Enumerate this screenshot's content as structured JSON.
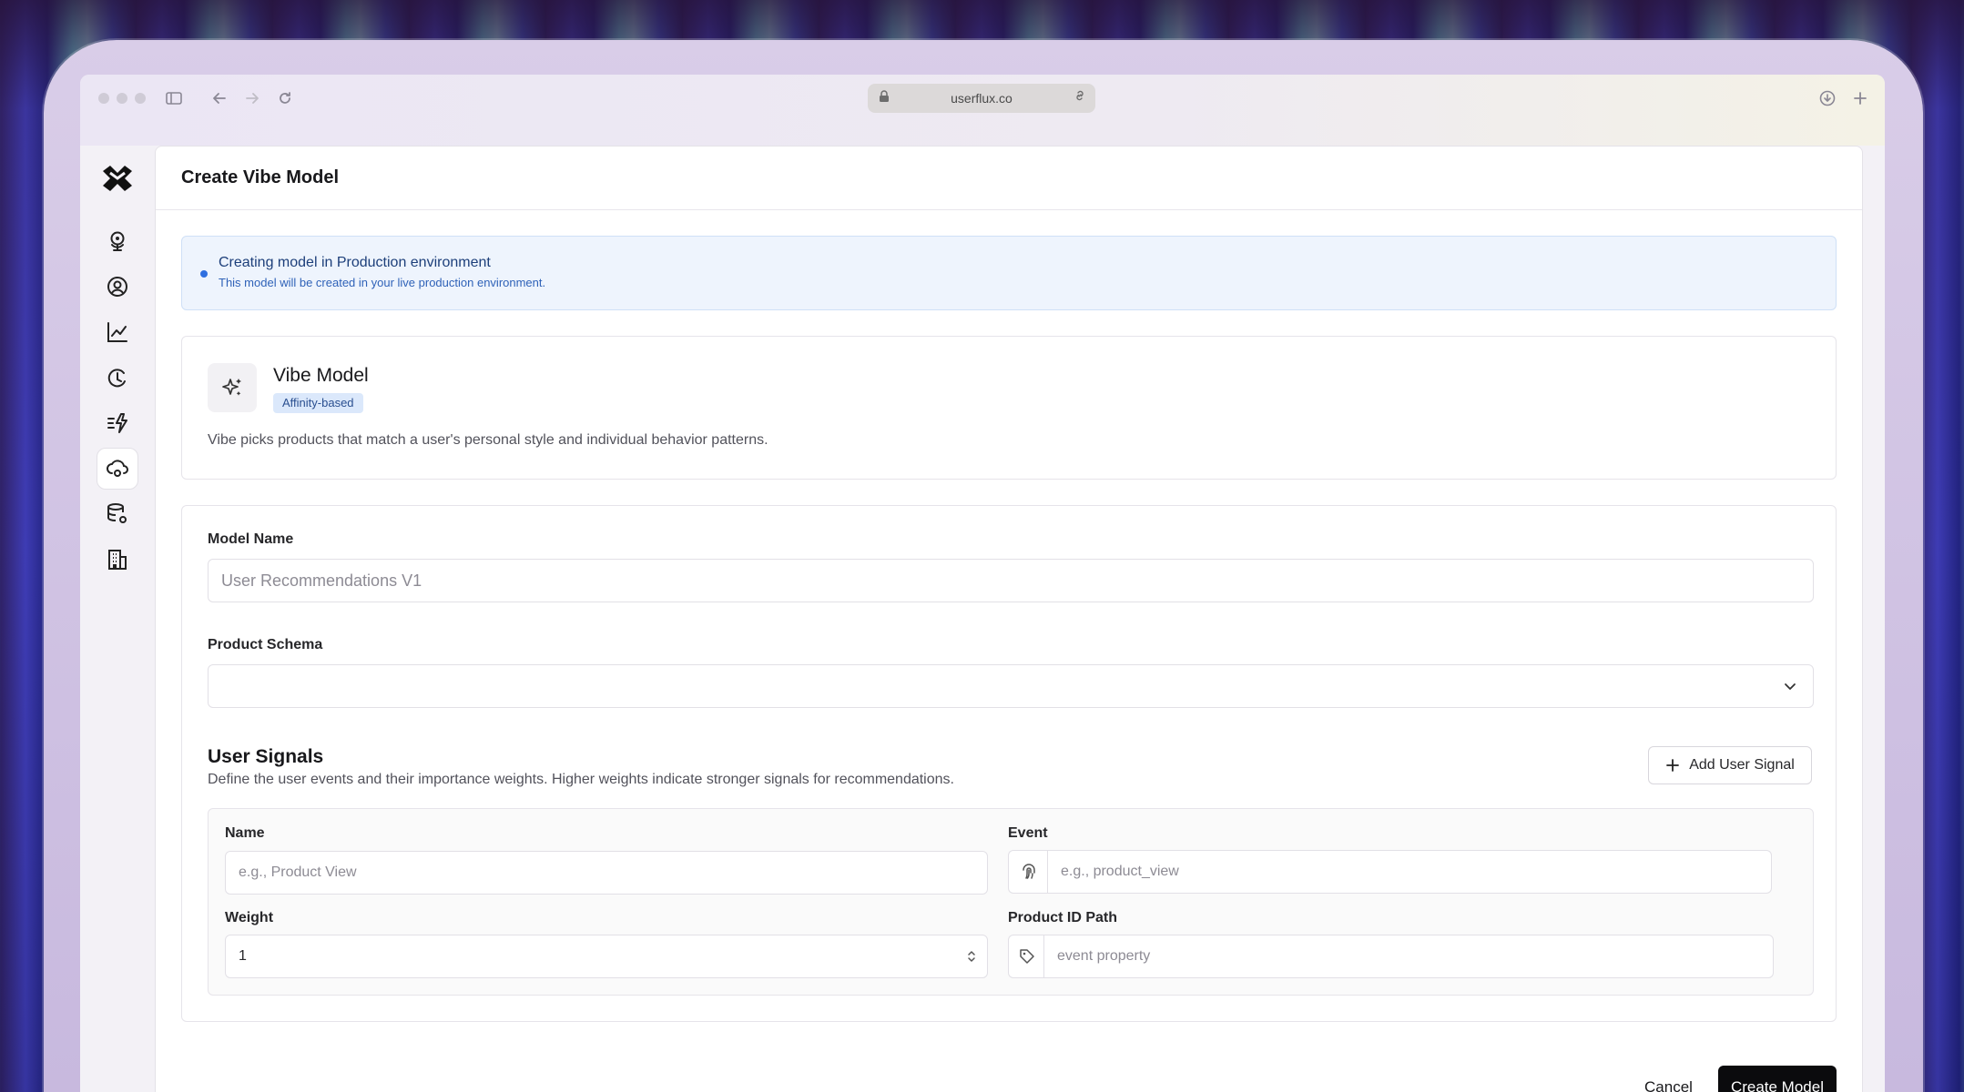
{
  "browser": {
    "url": "userflux.co"
  },
  "page": {
    "title": "Create Vibe Model"
  },
  "banner": {
    "title": "Creating model in Production environment",
    "subtitle": "This model will be created in your live production environment."
  },
  "model": {
    "name": "Vibe Model",
    "badge": "Affinity-based",
    "description": "Vibe picks products that match a user's personal style and individual behavior patterns."
  },
  "form": {
    "model_name_label": "Model Name",
    "model_name_placeholder": "User Recommendations V1",
    "product_schema_label": "Product Schema",
    "product_schema_value": ""
  },
  "signals": {
    "title": "User Signals",
    "description": "Define the user events and their importance weights. Higher weights indicate stronger signals for recommendations.",
    "add_label": "Add User Signal",
    "name_label": "Name",
    "name_placeholder": "e.g., Product View",
    "event_label": "Event",
    "event_placeholder": "e.g., product_view",
    "weight_label": "Weight",
    "weight_value": "1",
    "product_id_label": "Product ID Path",
    "product_id_placeholder": "event property"
  },
  "actions": {
    "cancel_label": "Cancel",
    "create_label": "Create Model"
  },
  "colors": {
    "accent": "#2f6fe0",
    "primary_button": "#0b0b0d",
    "badge_bg": "#dbe8fb"
  }
}
